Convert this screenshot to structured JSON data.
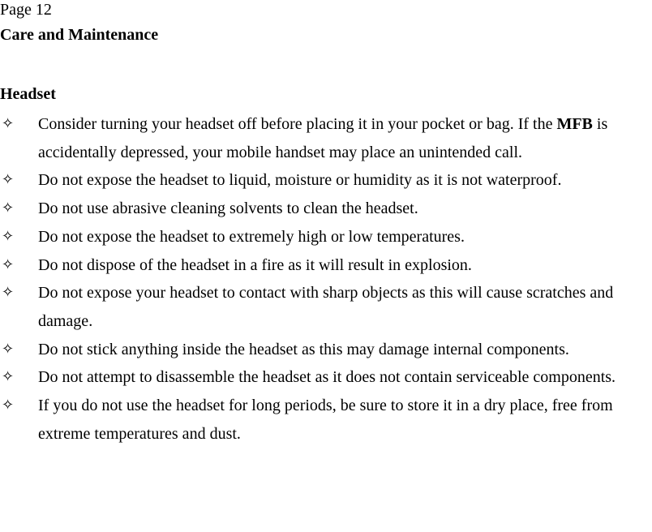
{
  "page": {
    "label": "Page 12",
    "section_title": "Care and Maintenance",
    "subsection_title": "Headset"
  },
  "bullet_icon": "white-four-pointed-star-icon",
  "bullet_glyph": "✧",
  "items": [
    {
      "pre": "Consider turning your headset off before placing it in your pocket or bag. If the ",
      "bold": "MFB",
      "post": " is accidentally depressed, your mobile handset may place an unintended call."
    },
    {
      "pre": "Do not expose the headset to liquid, moisture or humidity as it is not waterproof.",
      "bold": "",
      "post": ""
    },
    {
      "pre": "Do not use abrasive cleaning solvents to clean the headset.",
      "bold": "",
      "post": ""
    },
    {
      "pre": "Do not expose the headset to extremely high or low temperatures.",
      "bold": "",
      "post": ""
    },
    {
      "pre": "Do not dispose of the headset in a fire as it will result in explosion.",
      "bold": "",
      "post": ""
    },
    {
      "pre": "Do not expose your headset to contact with sharp objects as this will cause scratches and damage.",
      "bold": "",
      "post": ""
    },
    {
      "pre": "Do not stick anything inside the headset as this may damage internal components.",
      "bold": "",
      "post": ""
    },
    {
      "pre": "Do not attempt to disassemble the headset as it does not contain serviceable components.",
      "bold": "",
      "post": ""
    },
    {
      "pre": "If you do not use the headset for long periods, be sure to store it in a dry place, free from extreme temperatures and dust.",
      "bold": "",
      "post": ""
    }
  ]
}
